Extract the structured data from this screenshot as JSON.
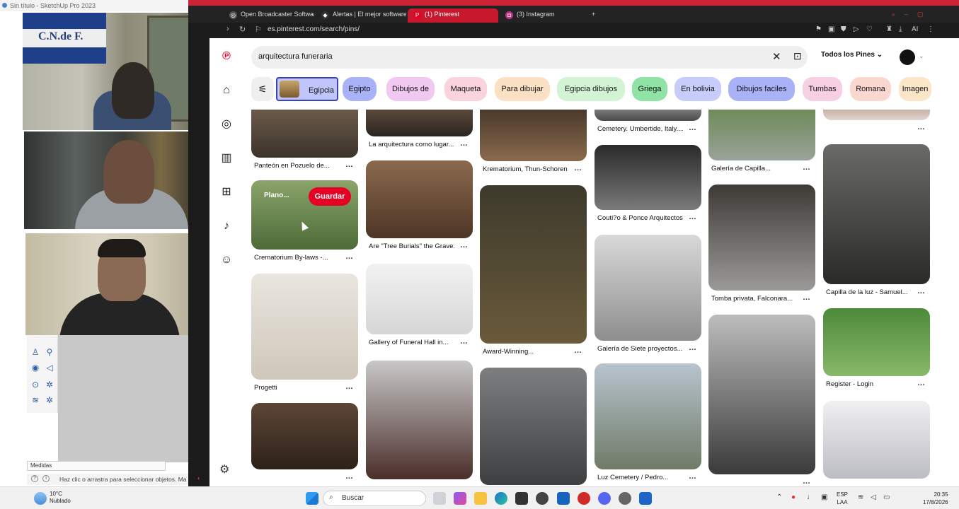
{
  "window": {
    "title": "Sin título - SketchUp Pro 2023"
  },
  "sketchup": {
    "measures_label": "Medidas",
    "status_text": "Haz clic o arrastra para seleccionar objetos. Ma"
  },
  "flag": {
    "text": "C.N.de F."
  },
  "browser": {
    "tabs": [
      {
        "label": "Open Broadcaster Softwar",
        "icon": "obs-icon"
      },
      {
        "label": "Alertas | El mejor software",
        "icon": "diamond-icon"
      },
      {
        "label": "(1) Pinterest",
        "icon": "pinterest-icon",
        "active": true
      },
      {
        "label": "(3) Instagram",
        "icon": "instagram-icon"
      }
    ],
    "new_tab": "+",
    "url": "es.pinterest.com/search/pins/",
    "ai_label": "AI"
  },
  "pinterest": {
    "search_query": "arquitectura funeraria",
    "scope_label": "Todos los Pines",
    "chips": [
      {
        "label": "Egipcia",
        "color": "#c0c6fb"
      },
      {
        "label": "Egipto",
        "color": "#a9b1f7"
      },
      {
        "label": "Dibujos de",
        "color": "#f1c8f2"
      },
      {
        "label": "Maqueta",
        "color": "#fad3dc"
      },
      {
        "label": "Para dibujar",
        "color": "#fbe0c4"
      },
      {
        "label": "Egipcia dibujos",
        "color": "#d2f3d4"
      },
      {
        "label": "Griega",
        "color": "#8fe3a4"
      },
      {
        "label": "En bolivia",
        "color": "#c7ccfb"
      },
      {
        "label": "Dibujos faciles",
        "color": "#a9b1f7"
      },
      {
        "label": "Tumbas",
        "color": "#f6cfe5"
      },
      {
        "label": "Romana",
        "color": "#fbd8cf"
      },
      {
        "label": "Imagen",
        "color": "#fbe6c8"
      }
    ],
    "hover_save": "Guardar",
    "hover_board": "Plano...",
    "pins": [
      {
        "title": "Panteón en Pozuelo de...",
        "col": 0
      },
      {
        "title": "Crematorium By-laws -...",
        "col": 0
      },
      {
        "title": "Progetti",
        "col": 0
      },
      {
        "title": "",
        "col": 0
      },
      {
        "title": "La arquitectura como lugar...",
        "col": 1
      },
      {
        "title": "Are \"Tree Burials\" the Grave...",
        "col": 1
      },
      {
        "title": "Gallery of Funeral Hall in...",
        "col": 1
      },
      {
        "title": "",
        "col": 1
      },
      {
        "title": "Krematorium, Thun-Schoren",
        "col": 2
      },
      {
        "title": "Award-Winning...",
        "col": 2
      },
      {
        "title": "",
        "col": 2
      },
      {
        "title": "Cemetery. Umbertide, Italy....",
        "col": 3
      },
      {
        "title": "Couti?o & Ponce Arquitectos",
        "col": 3
      },
      {
        "title": "Galería de Siete proyectos...",
        "col": 3
      },
      {
        "title": "Luz Cemetery / Pedro...",
        "col": 3
      },
      {
        "title": "Galería de Capilla...",
        "col": 4
      },
      {
        "title": "Tomba privata, Falconara...",
        "col": 4
      },
      {
        "title": "",
        "col": 4
      },
      {
        "title": "",
        "col": 5
      },
      {
        "title": "Capilla de la luz - Samuel...",
        "col": 5
      },
      {
        "title": "Register - Login",
        "col": 5
      },
      {
        "title": "",
        "col": 5
      }
    ]
  },
  "taskbar": {
    "weather_temp": "10°C",
    "weather_desc": "Nublado",
    "search_label": "Buscar",
    "lang_top": "ESP",
    "lang_bottom": "LAA",
    "time": "20:35",
    "date": "17/8/2026"
  }
}
